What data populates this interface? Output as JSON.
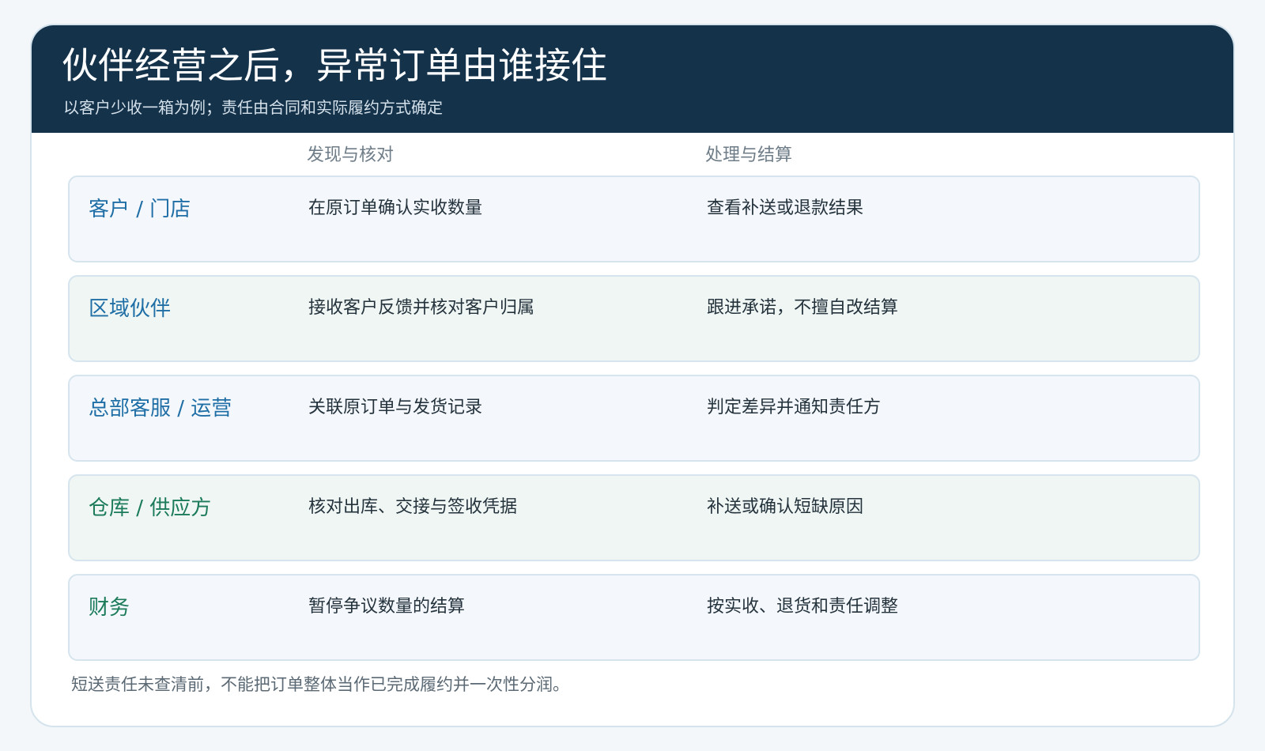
{
  "page": {
    "title": "伙伴经营之后，异常订单由谁接住",
    "subtitle": "以客户少收一箱为例；责任由合同和实际履约方式确定",
    "footer_note": "短送责任未查清前，不能把订单整体当作已完成履约并一次性分润。"
  },
  "columns": {
    "discovery": "发现与核对",
    "settlement": "处理与结算"
  },
  "rows": [
    {
      "role": "客户 / 门店",
      "discovery": "在原订单确认实收数量",
      "settlement": "查看补送或退款结果",
      "role_color": "#1f6ea5",
      "row_bg": "#f4f8fd"
    },
    {
      "role": "区域伙伴",
      "discovery": "接收客户反馈并核对客户归属",
      "settlement": "跟进承诺，不擅自改结算",
      "role_color": "#1f6ea5",
      "row_bg": "#eff6f4"
    },
    {
      "role": "总部客服 / 运营",
      "discovery": "关联原订单与发货记录",
      "settlement": "判定差异并通知责任方",
      "role_color": "#1f6ea5",
      "row_bg": "#f4f8fd"
    },
    {
      "role": "仓库 / 供应方",
      "discovery": "核对出库、交接与签收凭据",
      "settlement": "补送或确认短缺原因",
      "role_color": "#1b7b59",
      "row_bg": "#eff6f4"
    },
    {
      "role": "财务",
      "discovery": "暂停争议数量的结算",
      "settlement": "按实收、退货和责任调整",
      "role_color": "#1b7b59",
      "row_bg": "#f4f8fd"
    }
  ],
  "colors": {
    "header_bg": "#15324b",
    "page_bg": "#f3f7fa",
    "border": "#d6e4ed",
    "role_blue": "#1f6ea5",
    "role_green": "#1b7b59",
    "text_dark": "#24323c",
    "text_muted": "#6e7d88"
  }
}
